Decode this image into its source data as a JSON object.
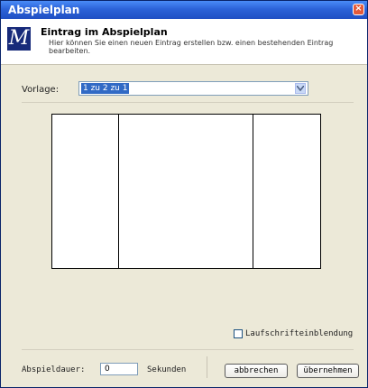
{
  "window": {
    "title": "Abspielplan",
    "close_glyph": "×"
  },
  "header": {
    "logo_letter": "M",
    "title": "Eintrag im Abspielplan",
    "subtitle": "Hier können Sie einen neuen Eintrag erstellen bzw. einen bestehenden Eintrag bearbeiten."
  },
  "vorlage": {
    "label": "Vorlage:",
    "selected": "1 zu 2 zu 1"
  },
  "layout_preview": {
    "panes": [
      "pane-1",
      "pane-2",
      "pane-3"
    ],
    "ratio": [
      1,
      2,
      1
    ]
  },
  "ticker": {
    "label": "Laufschrifteinblendung",
    "checked": false
  },
  "footer": {
    "duration_label": "Abspieldauer:",
    "duration_value": "0",
    "unit_label": "Sekunden",
    "cancel_label": "abbrechen",
    "apply_label": "übernehmen"
  },
  "colors": {
    "titlebar": "#2c63d8",
    "dialog_bg": "#ece9d8",
    "selection": "#316ac5",
    "logo_bg": "#172a7a"
  }
}
